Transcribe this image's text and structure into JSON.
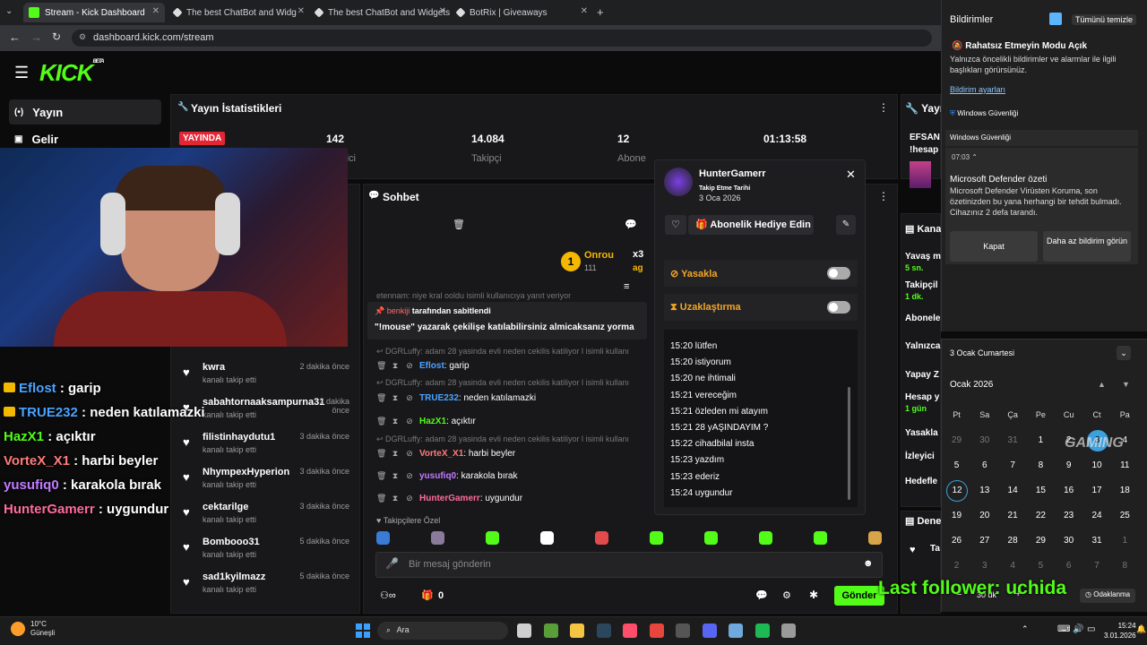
{
  "browser": {
    "tabs": [
      {
        "label": "Stream - Kick Dashboard",
        "color": "#53fc18"
      },
      {
        "label": "The best ChatBot and Widg",
        "color": "#888888"
      },
      {
        "label": "The best ChatBot and Widgets",
        "color": "#888888"
      },
      {
        "label": "BotRix | Giveaways",
        "color": "#888888"
      }
    ],
    "url": "dashboard.kick.com/stream"
  },
  "kick": {
    "logo": "KICK",
    "beta": "BETA",
    "sidebar": [
      {
        "label": "Yayın",
        "icon": "broadcast-icon"
      },
      {
        "label": "Gelir",
        "icon": "dashboard-icon"
      }
    ]
  },
  "stats": {
    "title": "Yayın İstatistikleri",
    "live_badge": "YAYINDA",
    "viewers": "142",
    "viewers_label": "İzleyici",
    "followers": "14.084",
    "followers_label": "Takipçi",
    "subs": "12",
    "subs_label": "Abone",
    "duration": "01:13:58"
  },
  "recent_followers": [
    {
      "name": "kwra",
      "sub": "kanalı takip etti",
      "time": "2 dakika önce"
    },
    {
      "name": "sabahtornaaksampurna31",
      "sub": "kanalı takip etti",
      "time": "2 dakika önce"
    },
    {
      "name": "filistinhaydutu1",
      "sub": "kanalı takip etti",
      "time": "3 dakika önce"
    },
    {
      "name": "NhympexHyperion",
      "sub": "kanalı takip etti",
      "time": "3 dakika önce"
    },
    {
      "name": "cektarilge",
      "sub": "kanalı takip etti",
      "time": "3 dakika önce"
    },
    {
      "name": "Bombooo31",
      "sub": "kanalı takip etti",
      "time": "5 dakika önce"
    },
    {
      "name": "sad1kyilmazz",
      "sub": "kanalı takip etti",
      "time": "5 dakika önce"
    }
  ],
  "chat": {
    "title": "Sohbet",
    "top_user": "Onrou",
    "top_count": "111",
    "top_mult": "x3",
    "top_tag": "ag",
    "pinned_by_prefix": "",
    "pinned_by_user": "benkiji",
    "pinned_by_suffix": "tarafından sabitlendi",
    "pinned_text": "\"!mouse\" yazarak çekilişe katılabilirsiniz almicaksanız yorma",
    "ghost_top": "etennam: niye kral ooldu isimli kullanıcıya yanıt veriyor",
    "messages": [
      {
        "reply": "DGRLuffy: adam 28 yasinda evli neden cekilis katiliyor l isimli kullanı",
        "user": "Eflost",
        "text": ": garip",
        "color": "#4aa3ff"
      },
      {
        "reply": "DGRLuffy: adam 28 yasinda evli neden cekilis katiliyor l isimli kullanı",
        "user": "TRUE232",
        "text": ": neden katılamazki",
        "color": "#4aa3ff"
      },
      {
        "reply": "",
        "user": "HazX1",
        "text": ": açıktır",
        "color": "#53fc18"
      },
      {
        "reply": "DGRLuffy: adam 28 yasinda evli neden cekilis katiliyor l isimli kullanı",
        "user": "VorteX_X1",
        "text": ": harbi beyler",
        "color": "#ff7b7b"
      },
      {
        "reply": "",
        "user": "yusufiq0",
        "text": ": karakola bırak",
        "color": "#c27bff"
      },
      {
        "reply": "",
        "user": "HunterGamerr",
        "text": ": uygundur",
        "color": "#ff6b9a"
      }
    ],
    "followers_only": "Takipçilere Özel",
    "input_placeholder": "Bir mesaj gönderin",
    "points": "0",
    "send": "Gönder"
  },
  "user_popup": {
    "name": "HunterGamerr",
    "follow_date_label": "Takip Etme Tarihi",
    "follow_date": "3 Oca 2026",
    "gift_button": "Abonelik Hediye Edin",
    "ban_label": "Yasakla",
    "timeout_label": "Uzaklaştırma",
    "history": [
      "15:20 lütfen",
      "15:20 istiyorum",
      "15:20 ne ihtimali",
      "15:21 vereceğim",
      "15:21 özleden mi atayım",
      "15:21 28 yAŞINDAYIM ?",
      "15:22 cihadbilal insta",
      "15:23 yazdım",
      "15:23 ederiz",
      "15:24 uygundur"
    ]
  },
  "overlay_chat": [
    {
      "user": "Eflost",
      "text": " : garip",
      "color": "#4aa3ff"
    },
    {
      "user": "TRUE232",
      "text": " : neden katılamazki",
      "color": "#4aa3ff"
    },
    {
      "user": "HazX1",
      "text": " : açıktır",
      "color": "#53fc18"
    },
    {
      "user": "VorteX_X1",
      "text": " : harbi beyler",
      "color": "#ff7b7b"
    },
    {
      "user": "yusufiq0",
      "text": " : karakola bırak",
      "color": "#c27bff"
    },
    {
      "user": "HunterGamerr",
      "text": " : uygundur",
      "color": "#ff6b9a"
    }
  ],
  "overlay_follower": "Last follower: uchida",
  "right_panel": {
    "title": "Yayın",
    "efsan": "EFSAN",
    "hesap": "!hesap",
    "kanal": "Kana",
    "rows": [
      {
        "label": "Yavaş m",
        "sub": "5 sn."
      },
      {
        "label": "Takipçil",
        "sub": "1 dk."
      },
      {
        "label": "Abonele",
        "sub": ""
      },
      {
        "label": "Yalnızca",
        "sub": ""
      },
      {
        "label": "Yapay Z",
        "sub": ""
      },
      {
        "label": "Hesap y",
        "sub": "1 gün"
      },
      {
        "label": "Yasakla",
        "sub": ""
      },
      {
        "label": "İzleyici",
        "sub": ""
      },
      {
        "label": "Hedefle",
        "sub": ""
      }
    ],
    "dene": "Dene",
    "ta": "Ta"
  },
  "notifications": {
    "title": "Bildirimler",
    "clear_all": "Tümünü temizle",
    "dnd_title": "Rahatsız Etmeyin Modu Açık",
    "dnd_text": "Yalnızca öncelikli bildirimler ve alarmlar ile ilgili başlıkları görürsünüz.",
    "settings_link": "Bildirim ayarları",
    "app_name": "Windows Güvenliği",
    "group_name": "Windows Güvenliği",
    "time": "07:03",
    "defender_title": "Microsoft Defender özeti",
    "defender_text": "Microsoft Defender Virüsten Koruma, son özetinizden bu yana herhangi bir tehdit bulmadı. Cihazınız 2 defa tarandı.",
    "close_btn": "Kapat",
    "less_btn": "Daha az bildirim görün"
  },
  "calendar": {
    "date_header": "3 Ocak Cumartesi",
    "month": "Ocak 2026",
    "weekdays": [
      "Pt",
      "Sa",
      "Ça",
      "Pe",
      "Cu",
      "Ct",
      "Pa"
    ],
    "days": [
      [
        "29",
        "30",
        "31",
        "1",
        "2",
        "3",
        "4"
      ],
      [
        "5",
        "6",
        "7",
        "8",
        "9",
        "10",
        "11"
      ],
      [
        "12",
        "13",
        "14",
        "15",
        "16",
        "17",
        "18"
      ],
      [
        "19",
        "20",
        "21",
        "22",
        "23",
        "24",
        "25"
      ],
      [
        "26",
        "27",
        "28",
        "29",
        "30",
        "31",
        "1"
      ],
      [
        "2",
        "3",
        "4",
        "5",
        "6",
        "7",
        "8"
      ]
    ],
    "focus_minutes": "30 dk",
    "focus_label": "Odaklanma",
    "watermark": "GAMING"
  },
  "taskbar": {
    "weather_temp": "10°C",
    "weather_text": "Güneşli",
    "search": "Ara",
    "time": "15:24",
    "date": "3.01.2026"
  }
}
